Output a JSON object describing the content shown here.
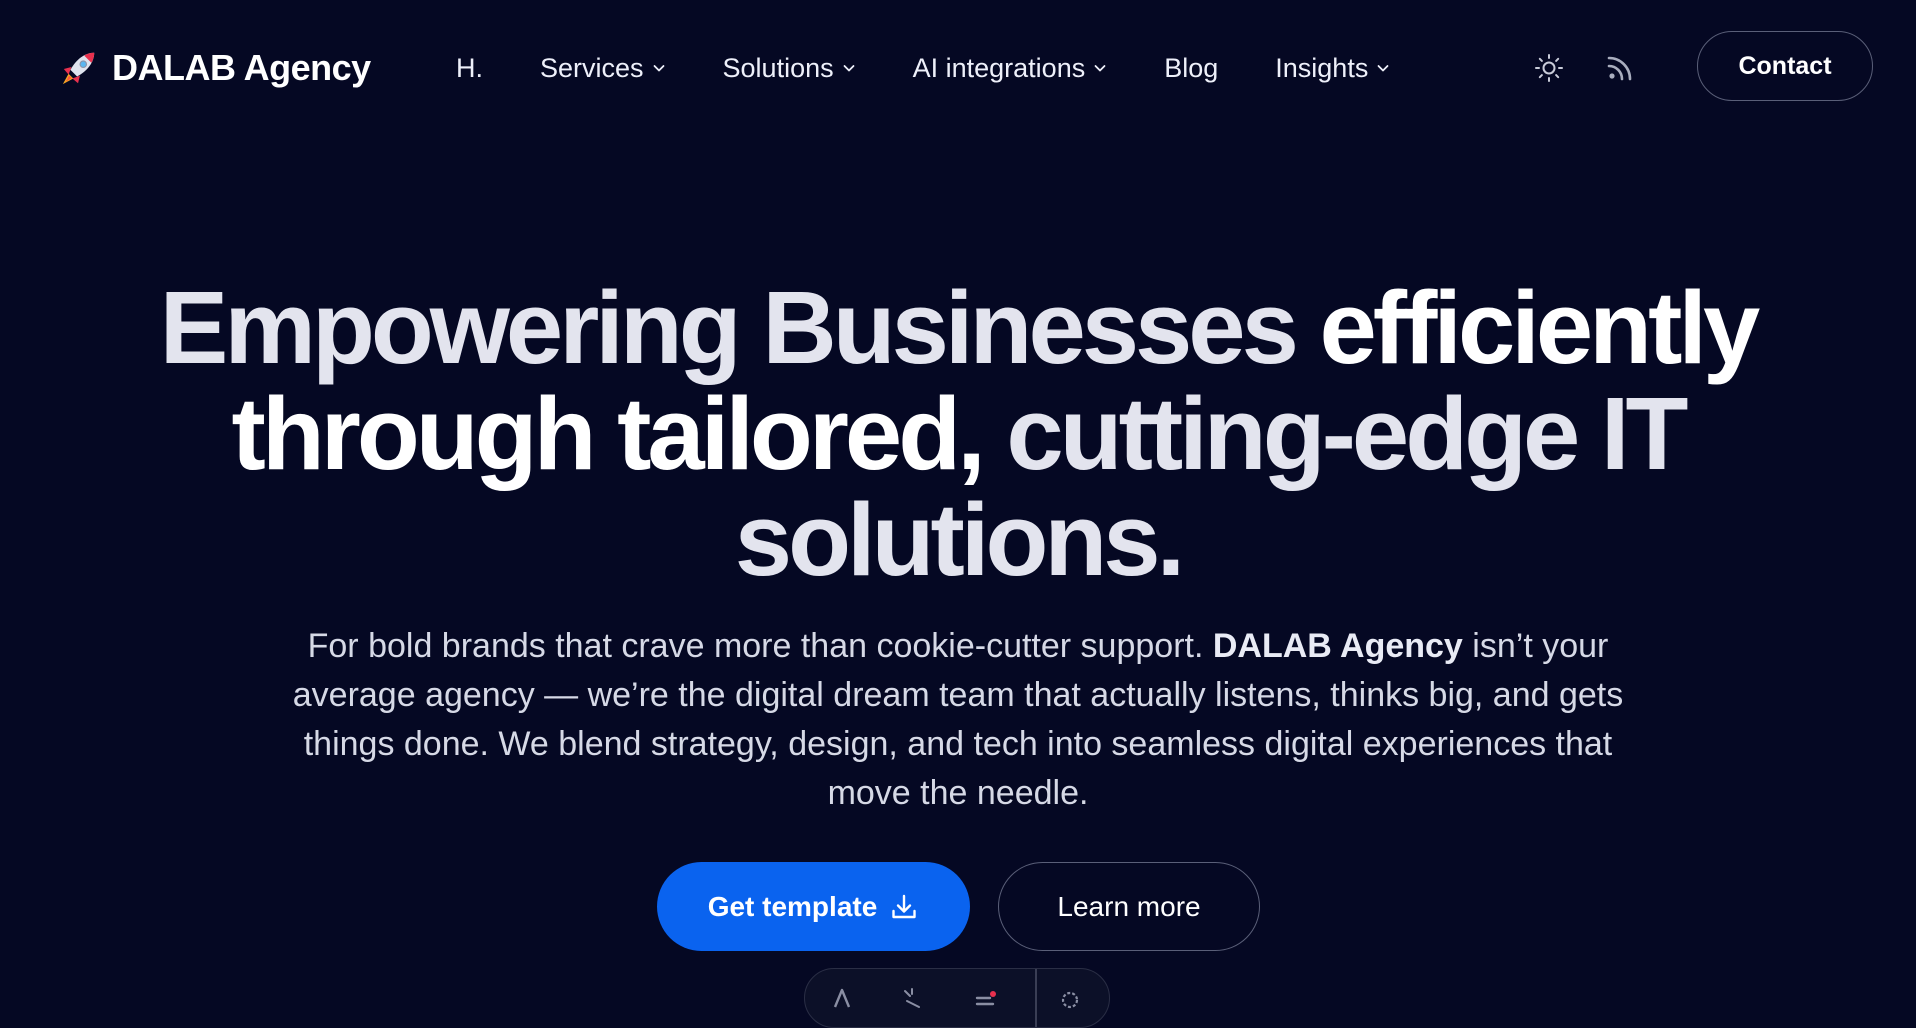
{
  "brand": {
    "name": "DALAB Agency",
    "icon": "rocket-icon"
  },
  "nav": {
    "items": [
      {
        "label": "H.",
        "has_dropdown": false
      },
      {
        "label": "Services",
        "has_dropdown": true
      },
      {
        "label": "Solutions",
        "has_dropdown": true
      },
      {
        "label": "AI integrations",
        "has_dropdown": true
      },
      {
        "label": "Blog",
        "has_dropdown": false
      },
      {
        "label": "Insights",
        "has_dropdown": true
      }
    ],
    "theme_icon": "sun-icon",
    "rss_icon": "rss-icon",
    "contact_label": "Contact"
  },
  "hero": {
    "title_part1": "Empowering Businesses ",
    "title_part2": "efficiently through tailored,",
    "title_part3": " cutting-edge IT solutions.",
    "desc_before": "For bold brands that crave more than cookie-cutter support. ",
    "desc_brand": "DALAB Agency",
    "desc_after": " isn’t your average agency — we’re the digital dream team that actually listens, thinks big, and gets things done. We blend strategy, design, and tech into seamless digital experiences that move the needle.",
    "primary_cta": "Get template",
    "primary_cta_icon": "download-icon",
    "secondary_cta": "Learn more"
  },
  "colors": {
    "background": "#050823",
    "accent": "#0a63ef",
    "text": "#ffffff",
    "muted_text": "#d6d9e6",
    "border": "#5a5f78"
  }
}
